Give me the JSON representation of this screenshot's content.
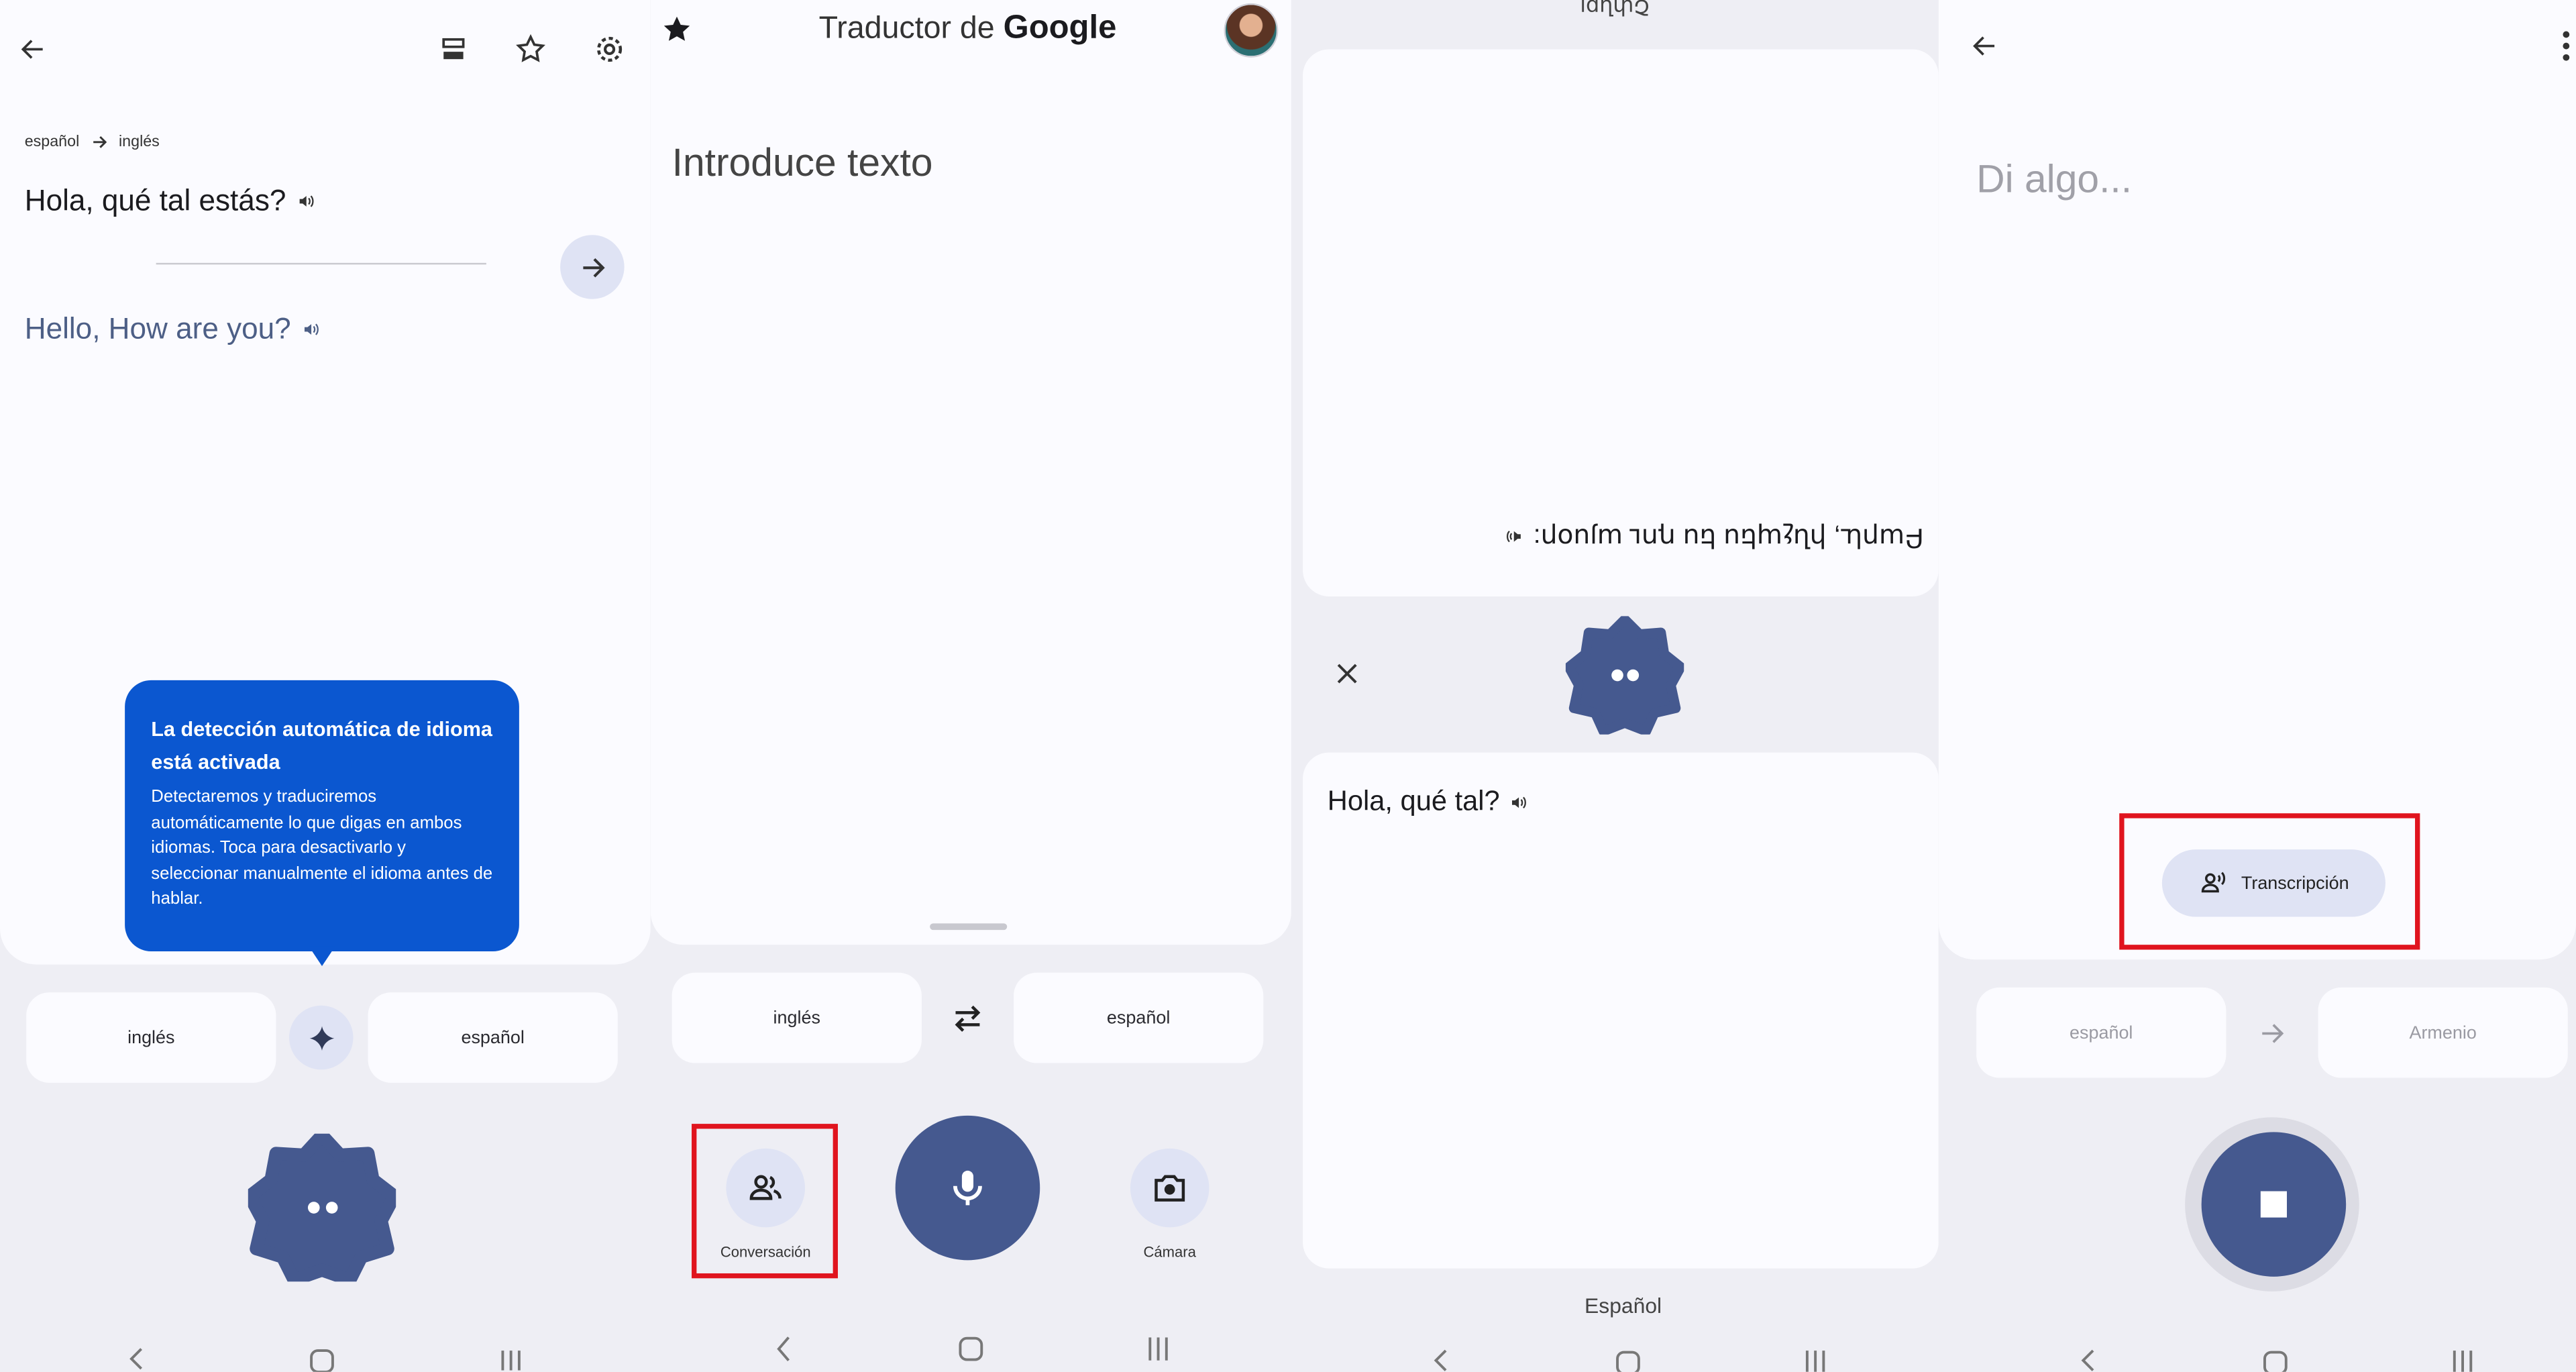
{
  "panel1": {
    "langs_from": "español",
    "langs_to": "inglés",
    "source_text": "Hola, qué tal estás?",
    "translated_text": "Hello, How are you?",
    "tooltip_title": "La detección automática de idioma está activada",
    "tooltip_body": "Detectaremos y traduciremos automáticamente lo que digas en ambos idiomas. Toca para desactivarlo y seleccionar manualmente el idioma antes de hablar.",
    "lang_left": "inglés",
    "lang_right": "español"
  },
  "panel2": {
    "title_prefix": "Traductor de",
    "title_brand": "Google",
    "placeholder": "Introduce texto",
    "lang_left": "inglés",
    "lang_right": "español",
    "conversation_label": "Conversación",
    "camera_label": "Cámara"
  },
  "panel3": {
    "top_fragment": "Շփնքլ",
    "armenian_text": "Բարև, ինչպես ես դու այսօր:",
    "spanish_text": "Hola, qué tal?",
    "bottom_lang": "Español"
  },
  "panel4": {
    "placeholder": "Di algo...",
    "transcription_label": "Transcripción",
    "lang_left": "español",
    "lang_right": "Armenio"
  },
  "colors": {
    "accent": "#45598f",
    "tooltip": "#0b57d0",
    "highlight": "#e0141e",
    "chip_blue": "#dfe3f4"
  },
  "icons": [
    "back-arrow-icon",
    "history-icon",
    "star-icon",
    "settings-gear-icon",
    "speaker-icon",
    "arrow-right-icon",
    "sparkle-icon",
    "swap-icon",
    "conversation-people-icon",
    "microphone-icon",
    "camera-icon",
    "close-icon",
    "stop-icon",
    "transcription-icon",
    "more-vert-icon",
    "nav-back-icon",
    "nav-home-icon",
    "nav-recents-icon"
  ]
}
